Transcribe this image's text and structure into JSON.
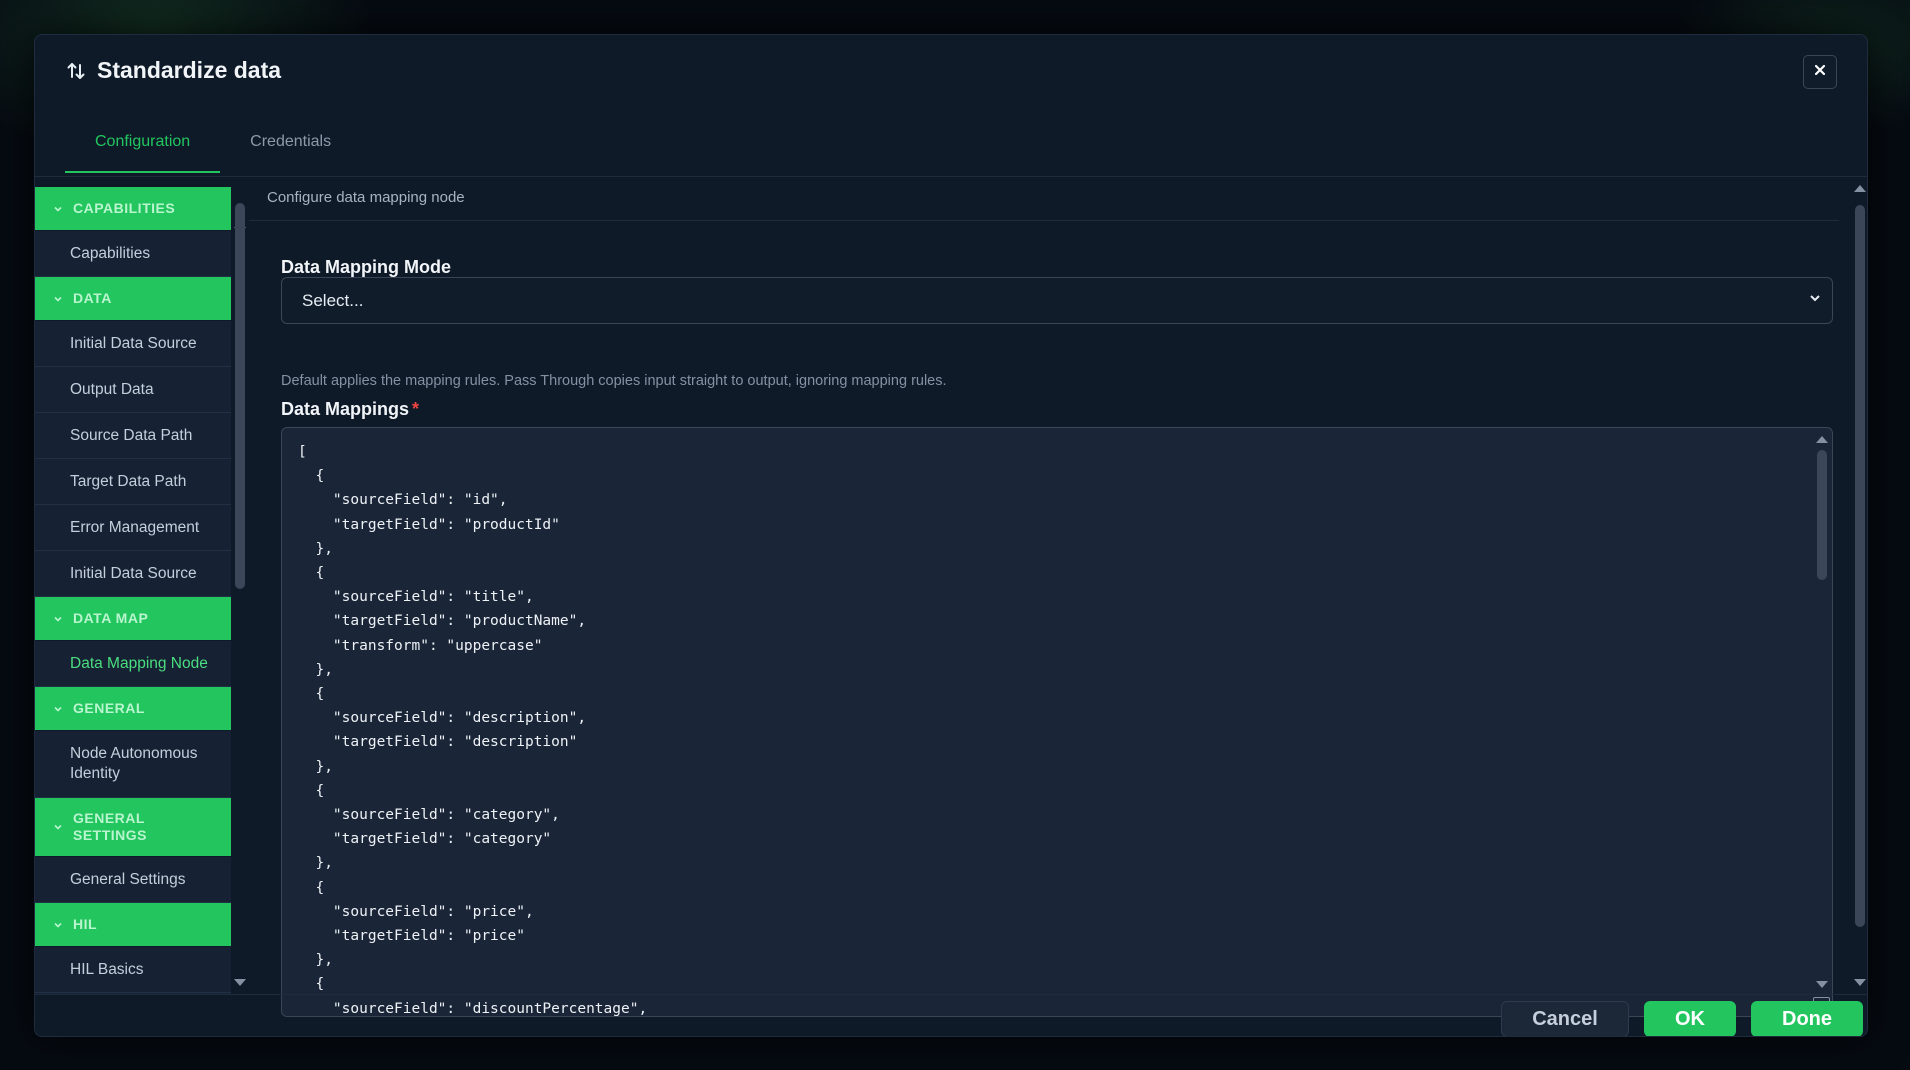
{
  "dialog": {
    "title": "Standardize data",
    "title_icon": "swap-vertical-icon",
    "close_icon": "close-icon"
  },
  "tabs": [
    {
      "label": "Configuration",
      "active": true
    },
    {
      "label": "Credentials",
      "active": false
    }
  ],
  "sidebar": {
    "groups": [
      {
        "label": "CAPABILITIES",
        "items": [
          "Capabilities"
        ]
      },
      {
        "label": "DATA",
        "items": [
          "Initial Data Source",
          "Output Data",
          "Source Data Path",
          "Target Data Path",
          "Error Management",
          "Initial Data Source"
        ]
      },
      {
        "label": "DATA MAP",
        "items": [
          "Data Mapping Node"
        ]
      },
      {
        "label": "GENERAL",
        "items": [
          "Node Autonomous Identity"
        ]
      },
      {
        "label": "GENERAL SETTINGS",
        "items": [
          "General Settings"
        ]
      },
      {
        "label": "HIL",
        "items": [
          "HIL Basics"
        ]
      }
    ],
    "active_item": "Data Mapping Node"
  },
  "content": {
    "subtitle": "Configure data mapping node",
    "mode_label": "Data Mapping Mode",
    "mode_value": "Select...",
    "mode_help": "Default applies the mapping rules. Pass Through copies input straight to output, ignoring mapping rules.",
    "mappings_label": "Data Mappings",
    "required_mark": "*",
    "mappings_code": "[\n  {\n    \"sourceField\": \"id\",\n    \"targetField\": \"productId\"\n  },\n  {\n    \"sourceField\": \"title\",\n    \"targetField\": \"productName\",\n    \"transform\": \"uppercase\"\n  },\n  {\n    \"sourceField\": \"description\",\n    \"targetField\": \"description\"\n  },\n  {\n    \"sourceField\": \"category\",\n    \"targetField\": \"category\"\n  },\n  {\n    \"sourceField\": \"price\",\n    \"targetField\": \"price\"\n  },\n  {\n    \"sourceField\": \"discountPercentage\","
  },
  "footer": {
    "cancel": "Cancel",
    "ok": "OK",
    "done": "Done"
  },
  "colors": {
    "accent": "#22c55e",
    "background": "#0f1a29",
    "required": "#ef4444"
  }
}
